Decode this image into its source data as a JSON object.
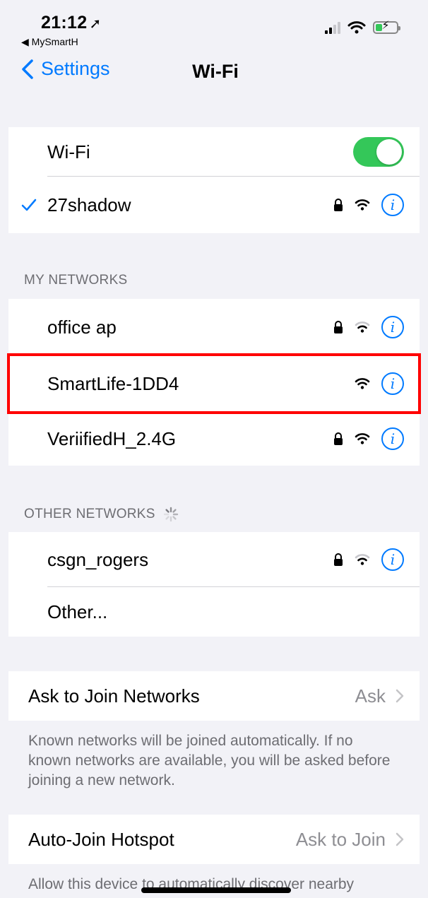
{
  "status_bar": {
    "time": "21:12",
    "back_app": "◀ MySmartH"
  },
  "nav": {
    "back_label": "Settings",
    "title": "Wi-Fi"
  },
  "wifi_toggle": {
    "label": "Wi-Fi",
    "on": true
  },
  "connected": {
    "name": "27shadow",
    "locked": true
  },
  "my_networks": {
    "header": "MY NETWORKS",
    "items": [
      {
        "name": "office ap",
        "locked": true
      },
      {
        "name": "SmartLife-1DD4",
        "locked": false
      },
      {
        "name": "VeriifiedH_2.4G",
        "locked": true
      }
    ]
  },
  "other_networks": {
    "header": "OTHER NETWORKS",
    "items": [
      {
        "name": "csgn_rogers",
        "locked": true
      }
    ],
    "other_label": "Other..."
  },
  "ask_to_join": {
    "label": "Ask to Join Networks",
    "value": "Ask",
    "footer": "Known networks will be joined automatically. If no known networks are available, you will be asked before joining a new network."
  },
  "auto_join": {
    "label": "Auto-Join Hotspot",
    "value": "Ask to Join",
    "footer": "Allow this device to automatically discover nearby"
  },
  "colors": {
    "accent": "#007aff",
    "toggle_on": "#34c759",
    "highlight": "#ff0000"
  }
}
